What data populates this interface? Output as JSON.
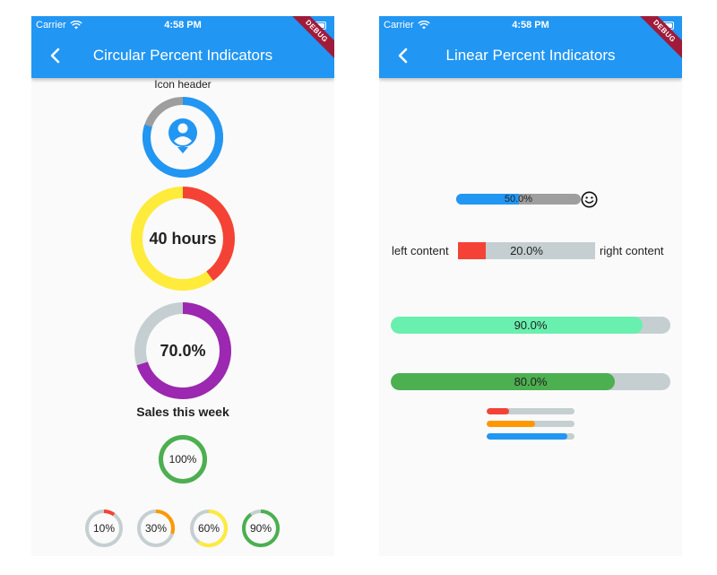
{
  "status": {
    "carrier": "Carrier",
    "time": "4:58 PM"
  },
  "debug_label": "DEBUG",
  "circular": {
    "title": "Circular Percent Indicators",
    "icon_header": {
      "label": "Icon header",
      "percent": 0.8,
      "progress_color": "#2196f3",
      "track_color": "#9e9e9e"
    },
    "hours": {
      "label": "40 hours",
      "percent": 0.4,
      "progress_color": "#f44336",
      "track_color": "#ffeb3b"
    },
    "seventy": {
      "label": "70.0%",
      "percent": 0.7,
      "progress_color": "#9c27b0",
      "track_color": "#c5cfd1"
    },
    "sales_label": "Sales this week",
    "hundred": {
      "label": "100%",
      "percent": 1.0,
      "progress_color": "#4caf50",
      "track_color": "#c5cfd1"
    },
    "small": [
      {
        "label": "10%",
        "percent": 0.1,
        "progress_color": "#f44336",
        "track_color": "#c5cfd1"
      },
      {
        "label": "30%",
        "percent": 0.3,
        "progress_color": "#ff9800",
        "track_color": "#c5cfd1"
      },
      {
        "label": "60%",
        "percent": 0.6,
        "progress_color": "#ffeb3b",
        "track_color": "#c5cfd1"
      },
      {
        "label": "90%",
        "percent": 0.9,
        "progress_color": "#4caf50",
        "track_color": "#c5cfd1"
      }
    ]
  },
  "linear": {
    "title": "Linear Percent Indicators",
    "bar1": {
      "label": "50.0%",
      "percent": 0.5,
      "progress_color": "#2196f3",
      "track_color": "#9e9e9e"
    },
    "bar2": {
      "label": "20.0%",
      "percent": 0.2,
      "progress_color": "#f44336",
      "track_color": "#c5cfd1",
      "left_text": "left content",
      "right_text": "right content"
    },
    "bar3": {
      "label": "90.0%",
      "percent": 0.9,
      "progress_color": "#69f0ae",
      "track_color": "#c5cfd1"
    },
    "bar4": {
      "label": "80.0%",
      "percent": 0.8,
      "progress_color": "#4caf50",
      "track_color": "#c5cfd1"
    },
    "mini": [
      {
        "percent": 0.25,
        "progress_color": "#f44336",
        "track_color": "#c5cfd1"
      },
      {
        "percent": 0.55,
        "progress_color": "#ff9800",
        "track_color": "#c5cfd1"
      },
      {
        "percent": 0.92,
        "progress_color": "#2196f3",
        "track_color": "#c5cfd1"
      }
    ]
  }
}
